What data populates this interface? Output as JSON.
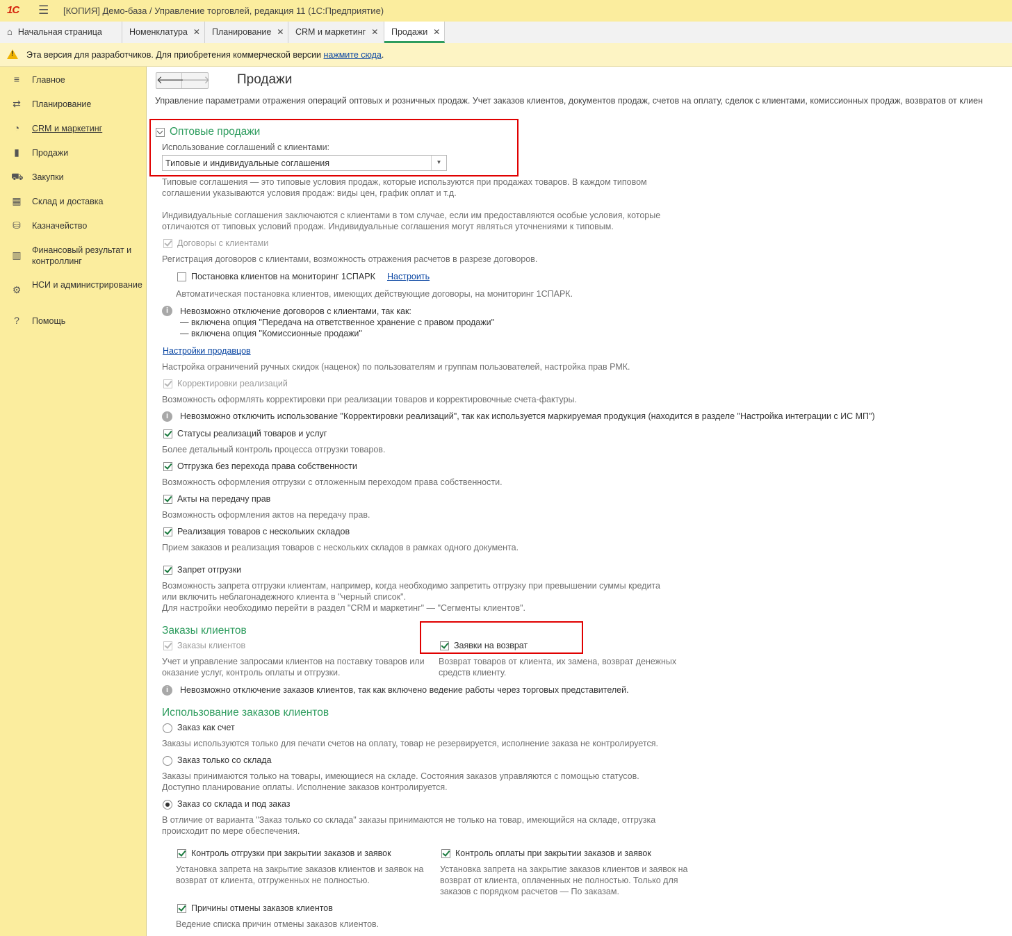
{
  "window": {
    "logo": "1С",
    "title": "[КОПИЯ] Демо-база / Управление торговлей, редакция 11  (1С:Предприятие)"
  },
  "tabs": [
    {
      "label": "Начальная страница"
    },
    {
      "label": "Номенклатура"
    },
    {
      "label": "Планирование"
    },
    {
      "label": "CRM и маркетинг"
    },
    {
      "label": "Продажи"
    }
  ],
  "warning": {
    "text": "Эта версия для разработчиков. Для приобретения коммерческой версии ",
    "link": "нажмите сюда",
    "suffix": "."
  },
  "sidebar": {
    "items": [
      {
        "label": "Главное",
        "icon": "list-icon"
      },
      {
        "label": "Планирование",
        "icon": "planning-icon"
      },
      {
        "label": "CRM и маркетинг",
        "icon": "pie-chart-icon"
      },
      {
        "label": "Продажи",
        "icon": "shopping-bag-icon"
      },
      {
        "label": "Закупки",
        "icon": "cart-icon"
      },
      {
        "label": "Склад и доставка",
        "icon": "warehouse-icon"
      },
      {
        "label": "Казначейство",
        "icon": "coins-icon"
      },
      {
        "label": "Финансовый результат и контроллинг",
        "icon": "bar-chart-icon"
      },
      {
        "label": "НСИ и администрирование",
        "icon": "gear-icon"
      },
      {
        "label": "Помощь",
        "icon": "help-icon"
      }
    ]
  },
  "page": {
    "title": "Продажи",
    "description": "Управление параметрами отражения операций оптовых и розничных продаж. Учет заказов клиентов, документов продаж, счетов на оплату, сделок с клиентами, комиссионных продаж, возвратов от клиен"
  },
  "wholesale": {
    "heading": "Оптовые продажи",
    "agreements_label": "Использование соглашений с клиентами:",
    "agreements_value": "Типовые и индивидуальные соглашения",
    "typical_hint_1": "Типовые соглашения — это типовые условия продаж, которые используются при продажах товаров. В каждом типовом",
    "typical_hint_2": "соглашении указываются условия продаж: виды цен, график оплат и т.д.",
    "individual_hint_1": "Индивидуальные соглашения заключаются с клиентами в том случае, если им предоставляются особые условия, которые",
    "individual_hint_2": "отличаются от типовых условий продаж. Индивидуальные соглашения могут являться уточнениями к типовым.",
    "contracts_label": "Договоры с клиентами",
    "contracts_hint": "Регистрация договоров с клиентами, возможность отражения расчетов в разрезе договоров.",
    "spark_label": "Постановка клиентов на мониторинг 1СПАРК",
    "spark_link": "Настроить",
    "spark_hint": "Автоматическая постановка клиентов, имеющих действующие договоры, на мониторинг 1СПАРК.",
    "contracts_info_1": "Невозможно отключение договоров с клиентами, так как:",
    "contracts_info_2": "— включена опция \"Передача на ответственное хранение с правом продажи\"",
    "contracts_info_3": "— включена опция \"Комиссионные продажи\"",
    "sellers_link": "Настройки продавцов",
    "sellers_hint": "Настройка ограничений ручных скидок (наценок) по пользователям и группам пользователей, настройка прав РМК.",
    "corrections_label": "Корректировки реализаций",
    "corrections_hint": "Возможность оформлять корректировки при реализации товаров и корректировочные счета-фактуры.",
    "corrections_info": "Невозможно отключить использование \"Корректировки реализаций\", так как используется маркируемая продукция (находится в разделе \"Настройка интеграции с ИС МП\")",
    "statuses_label": "Статусы реализаций товаров и услуг",
    "statuses_hint": "Более детальный контроль процесса отгрузки товаров.",
    "shipment_label": "Отгрузка без перехода права собственности",
    "shipment_hint": "Возможность оформления отгрузки с отложенным переходом права собственности.",
    "acts_label": "Акты на передачу прав",
    "acts_hint": "Возможность оформления актов на передачу прав.",
    "multi_wh_label": "Реализация товаров с нескольких складов",
    "multi_wh_hint": "Прием заказов и реализация товаров с нескольких складов в рамках одного документа.",
    "ban_label": "Запрет отгрузки",
    "ban_hint_1": "Возможность запрета отгрузки клиентам, например, когда необходимо запретить отгрузку при превышении суммы кредита",
    "ban_hint_2": "или включить неблагонадежного клиента в \"черный список\".",
    "ban_hint_3": "Для настройки необходимо перейти в раздел \"CRM и маркетинг\" — \"Сегменты клиентов\"."
  },
  "orders": {
    "heading": "Заказы клиентов",
    "orders_label": "Заказы клиентов",
    "orders_hint_1": "Учет и управление запросами клиентов на поставку товаров или",
    "orders_hint_2": "оказание услуг, контроль оплаты и отгрузки.",
    "returns_label": "Заявки на возврат",
    "returns_hint_1": "Возврат товаров от клиента, их замена, возврат денежных",
    "returns_hint_2": "средств клиенту.",
    "orders_info": "Невозможно отключение заказов клиентов, так как включено ведение работы через торговых представителей."
  },
  "usage": {
    "heading": "Использование заказов клиентов",
    "opt1_label": "Заказ как счет",
    "opt1_hint": "Заказы используются только для печати счетов на оплату, товар не резервируется, исполнение заказа не контролируется.",
    "opt2_label": "Заказ только со склада",
    "opt2_hint_1": "Заказы принимаются только на товары, имеющиеся на складе. Состояния заказов управляются с помощью статусов.",
    "opt2_hint_2": "Доступно планирование оплаты. Исполнение заказов контролируется.",
    "opt3_label": "Заказ со склада и под заказ",
    "opt3_hint_1": "В отличие от варианта \"Заказ только со склада\" заказы принимаются не только на товар, имеющийся на складе, отгрузка",
    "opt3_hint_2": "происходит по мере обеспечения.",
    "ship_ctrl_label": "Контроль отгрузки при закрытии заказов и заявок",
    "ship_ctrl_hint_1": "Установка запрета на закрытие заказов клиентов и заявок на",
    "ship_ctrl_hint_2": "возврат от клиента, отгруженных не полностью.",
    "pay_ctrl_label": "Контроль оплаты при закрытии заказов и заявок",
    "pay_ctrl_hint_1": "Установка запрета на закрытие заказов клиентов и заявок на",
    "pay_ctrl_hint_2": "возврат от клиента, оплаченных не полностью. Только для",
    "pay_ctrl_hint_3": "заказов с порядком расчетов — По заказам.",
    "cancel_label": "Причины отмены заказов клиентов",
    "cancel_hint": "Ведение списка причин отмены заказов клиентов."
  },
  "colors": {
    "accent_green": "#2e9c5e",
    "highlight_red": "#e00000",
    "sidebar_bg": "#fbed9e",
    "link_blue": "#0a46a3"
  }
}
